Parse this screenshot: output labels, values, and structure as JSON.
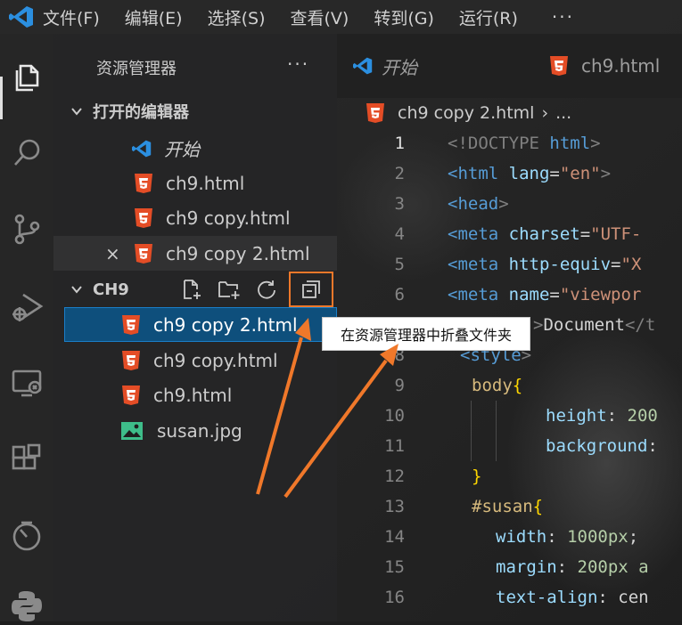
{
  "menubar": {
    "items": [
      "文件(F)",
      "编辑(E)",
      "选择(S)",
      "查看(V)",
      "转到(G)",
      "运行(R)"
    ],
    "more": "···"
  },
  "activity_bar": {
    "icons": [
      "explorer-icon",
      "search-icon",
      "source-control-icon",
      "run-debug-icon",
      "remote-explorer-icon",
      "extensions-icon",
      "timeline-icon",
      "python-icon"
    ]
  },
  "sidebar": {
    "title": "资源管理器",
    "more": "···",
    "open_editors": {
      "header": "打开的编辑器",
      "items": [
        "开始",
        "ch9.html",
        "ch9 copy.html",
        "ch9 copy 2.html"
      ],
      "close_glyph": "×"
    },
    "folder": {
      "header": "CH9",
      "files": [
        "ch9 copy 2.html",
        "ch9 copy.html",
        "ch9.html",
        "susan.jpg"
      ]
    },
    "tooltip": "在资源管理器中折叠文件夹"
  },
  "tabs": [
    "开始",
    "ch9.html"
  ],
  "breadcrumb": {
    "file": "ch9 copy 2.html",
    "sep": "›",
    "rest": "..."
  },
  "editor": {
    "line_numbers": [
      "1",
      "2",
      "3",
      "4",
      "5",
      "6",
      "7",
      "8",
      "9",
      "10",
      "11",
      "12",
      "13",
      "14",
      "15",
      "16"
    ],
    "lines": [
      [
        "<!DOCTYPE",
        " html",
        ">"
      ],
      [
        "<html",
        " lang",
        "=",
        "\"en\"",
        ">"
      ],
      [
        "<head",
        ">"
      ],
      [
        "<meta",
        " charset",
        "=",
        "\"UTF-"
      ],
      [
        "<meta",
        " http-equiv",
        "=",
        "\"X"
      ],
      [
        "<meta",
        " name",
        "=",
        "\"viewpor"
      ],
      [
        ">",
        "Document",
        "</t"
      ],
      [
        "<style",
        ">"
      ],
      [
        "body",
        "{"
      ],
      [
        "height",
        ": ",
        "200"
      ],
      [
        "background",
        ":"
      ],
      [
        "}"
      ],
      [
        "#susan",
        "{"
      ],
      [
        "width",
        ": ",
        "1000px",
        ";"
      ],
      [
        "margin",
        ": ",
        "200px a"
      ],
      [
        "text-align",
        ": ",
        "cen"
      ]
    ]
  },
  "colors": {
    "accent": "#f0782a",
    "selection": "#0e4f7c",
    "html5": "#e44d26",
    "vscode_blue": "#2b8fe0"
  }
}
